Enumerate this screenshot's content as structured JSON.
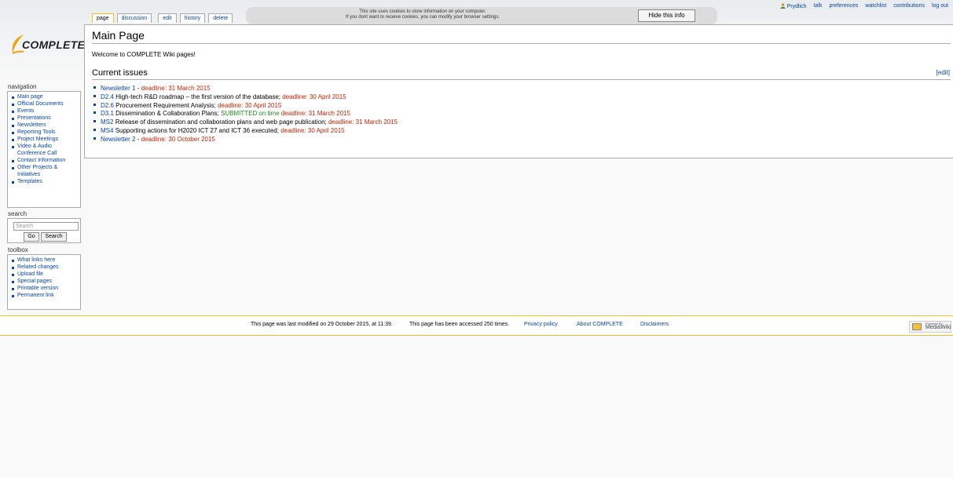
{
  "personal_tools": {
    "user": "Prydlich",
    "items": [
      "talk",
      "preferences",
      "watchlist",
      "contributions",
      "log out"
    ]
  },
  "tabs": [
    "page",
    "discussion",
    "edit",
    "history",
    "delete"
  ],
  "cookie_notice": {
    "line1": "This site uses cookies to store information on your computer.",
    "line2": "If you dont want to receive cookies, you can modify your browser settings.",
    "button": "Hide this info"
  },
  "logo": {
    "text": "COMPLETE"
  },
  "page": {
    "title": "Main Page",
    "welcome": "Welcome to COMPLETE Wiki pages!",
    "section_title": "Current issues",
    "edit_link": "[edit]"
  },
  "issues": [
    {
      "link": "Newsletter 1",
      "sep": " - ",
      "desc": "",
      "status": "",
      "deadline": "deadline: 31 March 2015"
    },
    {
      "link": "D2.4",
      "sep": " ",
      "desc": "High-tech R&D roadmap – the first version of the database; ",
      "status": "",
      "deadline": "deadline: 30 April 2015"
    },
    {
      "link": "D2.6",
      "sep": " ",
      "desc": "Procurement Requirement Analysis; ",
      "status": "",
      "deadline": "deadline: 30 April 2015"
    },
    {
      "link": "D3.1",
      "sep": " ",
      "desc": "Dissemination & Collaboration Plans; ",
      "status": "SUBMITTED on time ",
      "deadline": "deadline: 31 March 2015"
    },
    {
      "link": "MS2",
      "sep": " ",
      "desc": "Release of dissemination and collaboration plans and web page publication; ",
      "status": "",
      "deadline": "deadline: 31 March 2015"
    },
    {
      "link": "MS4",
      "sep": " ",
      "desc": "Supporting actions for H2020 ICT 27 and ICT 36 executed; ",
      "status": "",
      "deadline": "deadline: 30 April 2015"
    },
    {
      "link": "Newsletter 2",
      "sep": " - ",
      "desc": "",
      "status": "",
      "deadline": "deadline: 30 October 2015"
    }
  ],
  "navigation": {
    "title": "navigation",
    "items": [
      "Main page",
      "Official Documents",
      "Events",
      "Presentations",
      "Newsletters",
      "Reporting Tools",
      "Project Meetings",
      "Video & Audio Conference Call",
      "Contact Information",
      "Other Projects & Initiatives",
      "Templates"
    ]
  },
  "search": {
    "title": "search",
    "placeholder": "Search",
    "go": "Go",
    "button": "Search"
  },
  "toolbox": {
    "title": "toolbox",
    "items": [
      "What links here",
      "Related changes",
      "Upload file",
      "Special pages",
      "Printable version",
      "Permanent link"
    ]
  },
  "footer": {
    "last_modified": "This page was last modified on 29 October 2015, at 11:39.",
    "accessed": "This page has been accessed 250 times.",
    "privacy": "Privacy policy",
    "about": "About COMPLETE",
    "disclaimers": "Disclaimers",
    "badge_top": "Powered By",
    "badge_text": "MediaWiki"
  },
  "colors": {
    "link": "#0645ad",
    "deadline": "#cc2200",
    "submitted": "#1a8f1a",
    "accent_border": "#fabd23"
  }
}
